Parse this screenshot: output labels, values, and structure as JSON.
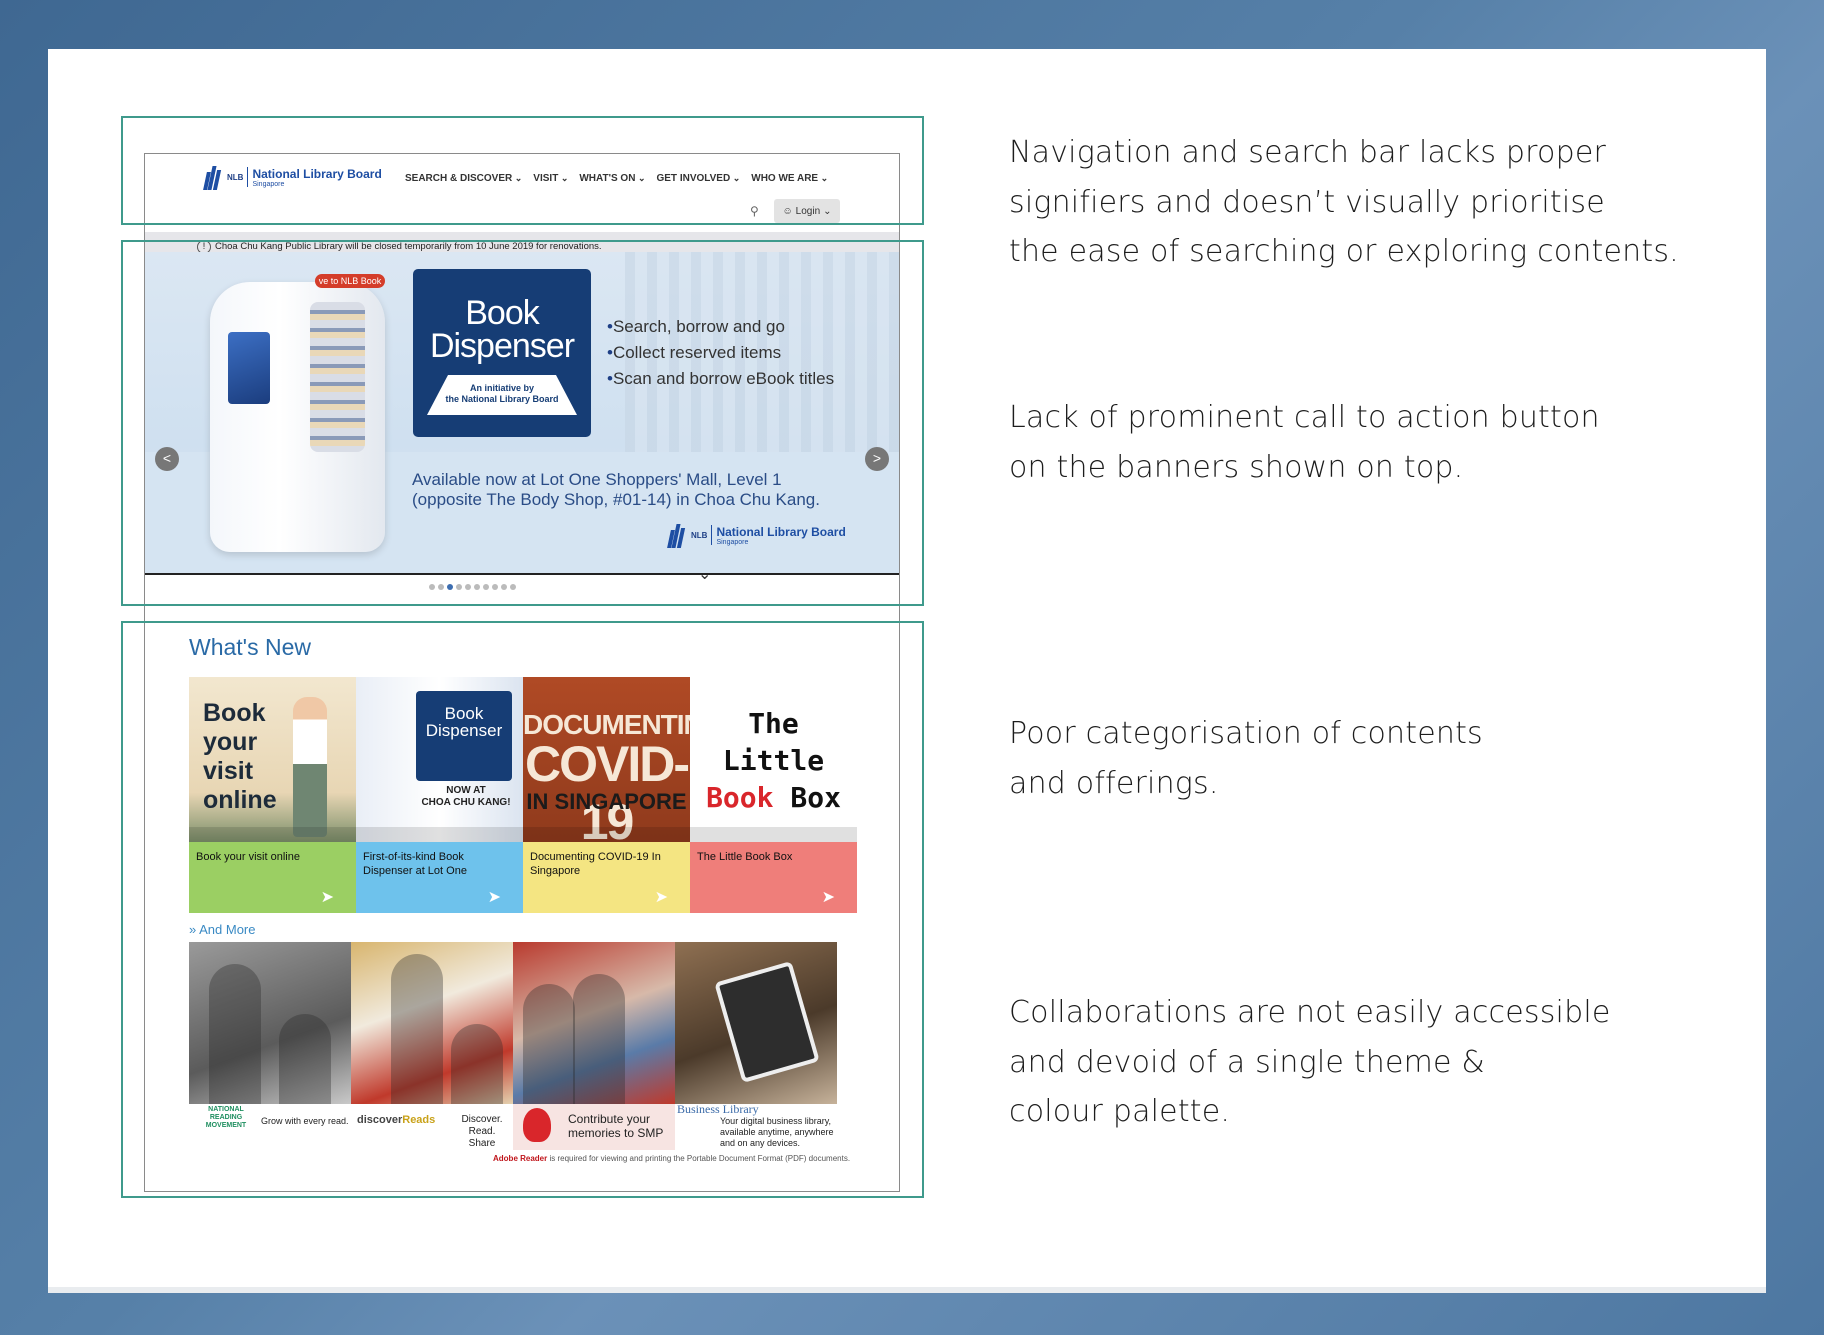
{
  "notes": [
    {
      "lines": [
        "Navigation and search bar lacks proper",
        "signifiers and doesn’t visually prioritise",
        "the ease of searching or exploring contents."
      ]
    },
    {
      "lines": [
        "Lack of prominent call to action button",
        "on the banners shown on top."
      ]
    },
    {
      "lines": [
        "Poor categorisation of contents",
        "and offerings."
      ]
    },
    {
      "lines": [
        "Collaborations are not easily accessible",
        "and devoid of a single theme &",
        "colour palette."
      ]
    }
  ],
  "header": {
    "logo_short": "NLB",
    "logo_title": "National Library Board",
    "logo_sub": "Singapore",
    "nav": [
      "SEARCH & DISCOVER",
      "VISIT",
      "WHAT'S ON",
      "GET INVOLVED",
      "WHO WE ARE"
    ],
    "search_icon": "search-icon",
    "login_label": "Login",
    "notice": "Choa Chu Kang Public Library will be closed temporarily from 10 June 2019 for renovations."
  },
  "banner": {
    "kiosk_tag": "ve to NLB Book",
    "title_line1": "Book",
    "title_line2": "Dispenser",
    "subtitle_line1": "An initiative by",
    "subtitle_line2": "the National Library Board",
    "bullets": [
      "Search, borrow and go",
      "Collect reserved items",
      "Scan and borrow eBook titles"
    ],
    "avail_line1": "Available now at Lot One Shoppers' Mall, Level 1",
    "avail_line2": "(opposite The Body Shop, #01-14) in Choa Chu Kang.",
    "prev": "<",
    "next": ">",
    "slides": 10,
    "active_slide": 3
  },
  "whats_new": {
    "title": "What's New",
    "tiles": [
      {
        "art": [
          "Book",
          "your",
          "visit",
          "online"
        ],
        "caption": "Book your visit online",
        "color": "#9bcf63"
      },
      {
        "art": [
          "Book",
          "Dispenser",
          "NOW AT",
          "CHOA CHU KANG!"
        ],
        "caption": "First-of-its-kind Book Dispenser at Lot One",
        "color": "#6ec2ec"
      },
      {
        "art": [
          "DOCUMENTING",
          "COVID-19",
          "IN SINGAPORE"
        ],
        "caption": "Documenting COVID-19 In Singapore",
        "color": "#f4e582"
      },
      {
        "art": [
          "The",
          "Little",
          "Book",
          "Box"
        ],
        "caption": "The Little Book Box",
        "color": "#ef7e7a"
      }
    ],
    "and_more": "And More"
  },
  "collaborations": [
    {
      "logo": "NATIONAL READING MOVEMENT",
      "text": "Grow with every read."
    },
    {
      "logo_a": "discover",
      "logo_b": "Reads",
      "text": "Discover. Read. Share"
    },
    {
      "text_line1": "Contribute your",
      "text_line2": "memories to SMP"
    },
    {
      "title": "Business Library",
      "text": "Your digital business library, available anytime, anywhere and on any devices."
    }
  ],
  "adobe": {
    "bold": "Adobe Reader",
    "rest": " is required for viewing and printing the Portable Document Format (PDF) documents."
  }
}
